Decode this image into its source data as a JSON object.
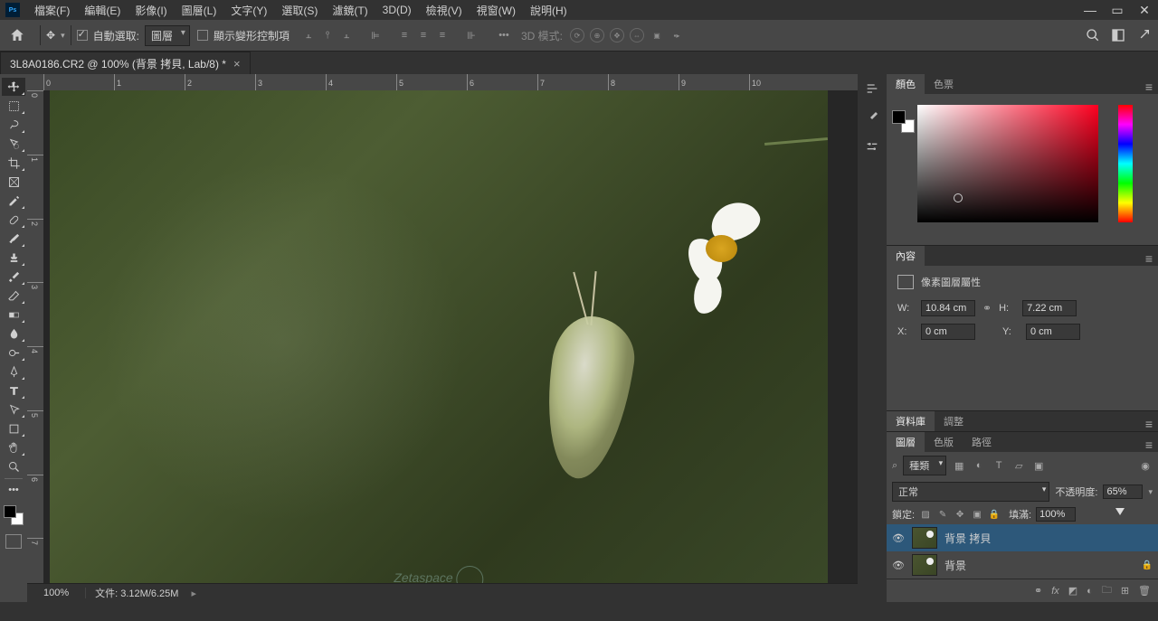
{
  "menubar": {
    "items": [
      "檔案(F)",
      "編輯(E)",
      "影像(I)",
      "圖層(L)",
      "文字(Y)",
      "選取(S)",
      "濾鏡(T)",
      "3D(D)",
      "檢視(V)",
      "視窗(W)",
      "說明(H)"
    ]
  },
  "option_bar": {
    "auto_select_label": "自動選取:",
    "auto_select_target": "圖層",
    "show_transform_label": "顯示變形控制項",
    "threed_label": "3D 模式:"
  },
  "document": {
    "tab_title": "3L8A0186.CR2 @ 100% (背景 拷貝, Lab/8) *",
    "ruler_h": [
      "0",
      "1",
      "2",
      "3",
      "4",
      "5",
      "6",
      "7",
      "8",
      "9",
      "10"
    ],
    "ruler_v": [
      "0",
      "1",
      "2",
      "3",
      "4",
      "5",
      "6",
      "7"
    ],
    "watermark": "Zetaspace"
  },
  "status": {
    "zoom": "100%",
    "docinfo": "文件: 3.12M/6.25M"
  },
  "panels": {
    "color": {
      "tab1": "顏色",
      "tab2": "色票"
    },
    "properties": {
      "tab": "內容",
      "title": "像素圖層屬性",
      "w_label": "W:",
      "w_value": "10.84 cm",
      "h_label": "H:",
      "h_value": "7.22 cm",
      "x_label": "X:",
      "x_value": "0 cm",
      "y_label": "Y:",
      "y_value": "0 cm"
    },
    "library": {
      "tab1": "資料庫",
      "tab2": "調整"
    },
    "layers": {
      "tab1": "圖層",
      "tab2": "色版",
      "tab3": "路徑",
      "filter_kind": "種類",
      "blend_mode": "正常",
      "opacity_label": "不透明度:",
      "opacity_value": "65%",
      "lock_label": "鎖定:",
      "fill_label": "填滿:",
      "fill_value": "100%",
      "items": [
        {
          "name": "背景 拷貝",
          "locked": false
        },
        {
          "name": "背景",
          "locked": true
        }
      ]
    }
  }
}
